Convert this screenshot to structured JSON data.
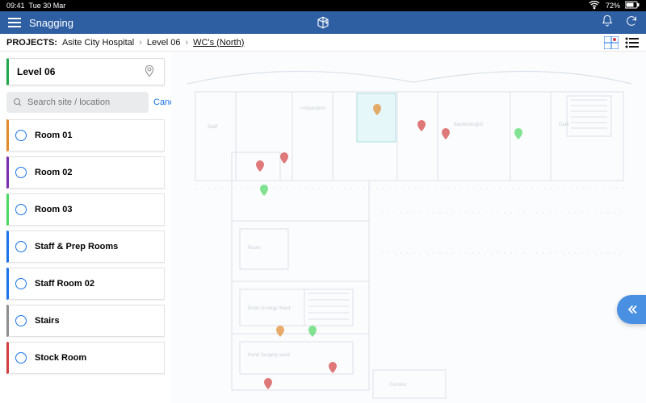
{
  "status": {
    "time": "09:41",
    "date": "Tue 30 Mar",
    "battery": "72%"
  },
  "header": {
    "title": "Snagging"
  },
  "breadcrumb": {
    "label": "PROJECTS:",
    "project": "Asite City Hospital",
    "level": "Level 06",
    "current": "WC's (North)"
  },
  "level_card": {
    "label": "Level 06"
  },
  "search": {
    "placeholder": "Search site / location",
    "cancel": "Cancel"
  },
  "rooms": [
    {
      "label": "Room 01",
      "color": "#e08a2a"
    },
    {
      "label": "Room 02",
      "color": "#7b2fb0"
    },
    {
      "label": "Room 03",
      "color": "#4cd964"
    },
    {
      "label": "Staff & Prep Rooms",
      "color": "#1a73e8"
    },
    {
      "label": "Staff Room 02",
      "color": "#1a73e8"
    },
    {
      "label": "Stairs",
      "color": "#8e8e8e"
    },
    {
      "label": "Stock Room",
      "color": "#d23f3f"
    }
  ]
}
